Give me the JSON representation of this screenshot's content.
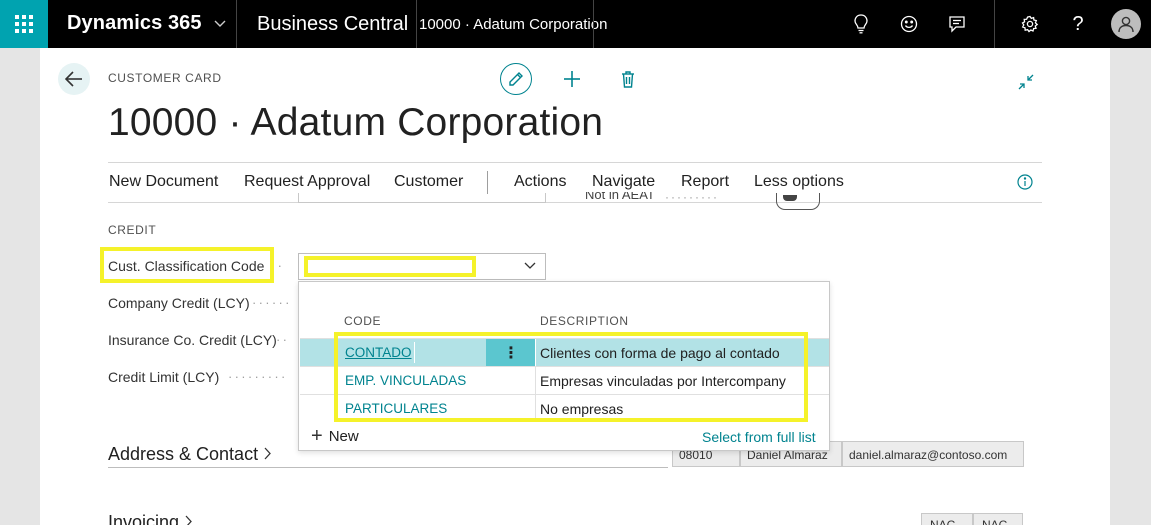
{
  "topbar": {
    "brand": "Dynamics 365",
    "app_name": "Business Central",
    "page_name": "10000 · Adatum Corporation"
  },
  "header": {
    "caption": "CUSTOMER CARD",
    "title": "10000 · Adatum Corporation"
  },
  "action_bar": {
    "items": [
      "New Document",
      "Request Approval",
      "Customer",
      "Actions",
      "Navigate",
      "Report",
      "Less options"
    ]
  },
  "partial_row": {
    "text": "Not in AEAT"
  },
  "credit": {
    "section_title": "CREDIT",
    "fields": [
      {
        "label": "Cust. Classification Code",
        "value": ""
      },
      {
        "label": "Company Credit (LCY)",
        "value": ""
      },
      {
        "label": "Insurance Co. Credit (LCY)",
        "value": ""
      },
      {
        "label": "Credit Limit (LCY)",
        "value": ""
      }
    ]
  },
  "dropdown": {
    "columns": [
      "CODE",
      "DESCRIPTION"
    ],
    "rows": [
      {
        "code": "CONTADO",
        "description": "Clientes con forma de pago al contado",
        "selected": true
      },
      {
        "code": "EMP. VINCULADAS",
        "description": "Empresas vinculadas por Intercompany",
        "selected": false
      },
      {
        "code": "PARTICULARES",
        "description": "No empresas",
        "selected": false
      }
    ],
    "new_label": "New",
    "full_list_label": "Select from full list"
  },
  "fasttabs": {
    "address": "Address & Contact",
    "invoicing": "Invoicing"
  },
  "address_cells": [
    "08010",
    "Daniel Almaraz",
    "daniel.almaraz@contoso.com"
  ],
  "invoicing_cells": [
    "NAC",
    "NAC"
  ],
  "colors": {
    "accent": "#00838f",
    "waffle": "#00a3b0",
    "highlight": "#f5f22a",
    "selected_row": "#b2e2e6"
  }
}
